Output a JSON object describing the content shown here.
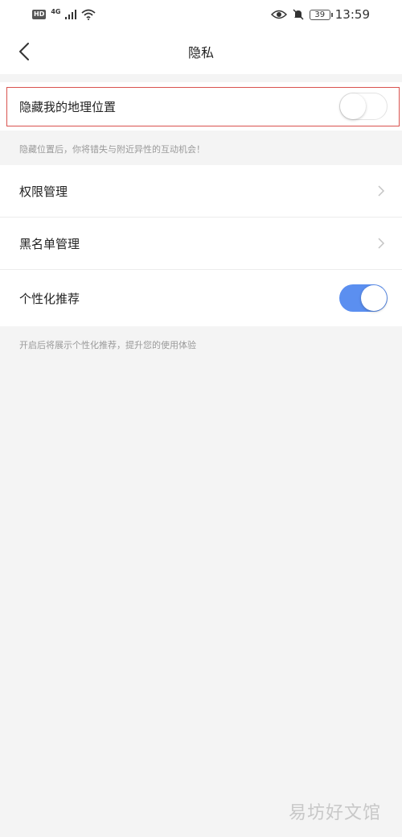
{
  "status_bar": {
    "hd": "HD",
    "network": "4G",
    "battery": "39",
    "time": "13:59"
  },
  "nav": {
    "title": "隐私"
  },
  "settings": {
    "hide_location": {
      "label": "隐藏我的地理位置",
      "enabled": false,
      "hint": "隐藏位置后，你将错失与附近异性的互动机会！"
    },
    "permissions": {
      "label": "权限管理"
    },
    "blacklist": {
      "label": "黑名单管理"
    },
    "personalized": {
      "label": "个性化推荐",
      "enabled": true,
      "hint": "开启后将展示个性化推荐，提升您的使用体验"
    }
  },
  "colors": {
    "accent": "#5b8ff0",
    "highlight_border": "#d9534f",
    "background": "#f4f4f4"
  },
  "watermark": "易坊好文馆"
}
